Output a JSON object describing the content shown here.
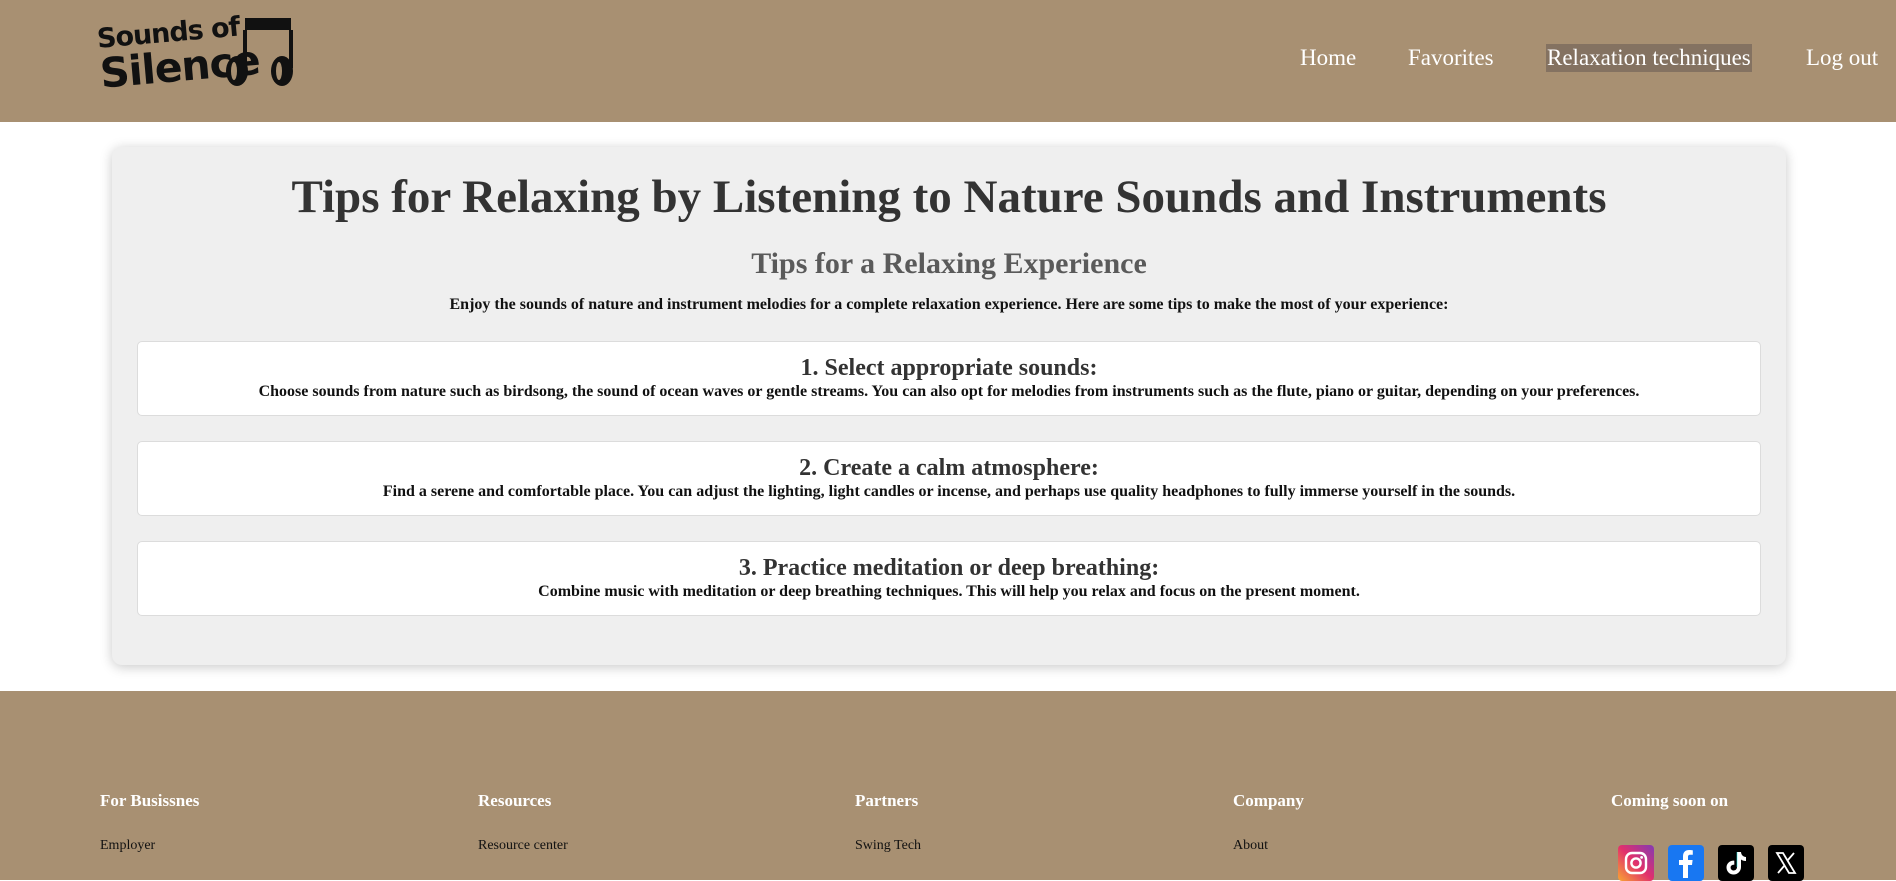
{
  "header": {
    "logo": {
      "line1": "Sounds of",
      "line2": "Silence",
      "icon": "headphones-icon"
    },
    "nav": [
      {
        "label": "Home"
      },
      {
        "label": "Favorites"
      },
      {
        "label": "Relaxation techniques",
        "active": true
      },
      {
        "label": "Log out"
      }
    ]
  },
  "main": {
    "title": "Tips for Relaxing by Listening to Nature Sounds and Instruments",
    "subtitle": "Tips for a Relaxing Experience",
    "intro": "Enjoy the sounds of nature and instrument melodies for a complete relaxation experience. Here are some tips to make the most of your experience:",
    "tips": [
      {
        "heading": "1. Select appropriate sounds:",
        "text": "Choose sounds from nature such as birdsong, the sound of ocean waves or gentle streams. You can also opt for melodies from instruments such as the flute, piano or guitar, depending on your preferences."
      },
      {
        "heading": "2. Create a calm atmosphere:",
        "text": "Find a serene and comfortable place. You can adjust the lighting, light candles or incense, and perhaps use quality headphones to fully immerse yourself in the sounds."
      },
      {
        "heading": "3. Practice meditation or deep breathing:",
        "text": "Combine music with meditation or deep breathing techniques. This will help you relax and focus on the present moment."
      }
    ]
  },
  "footer": {
    "columns": [
      {
        "heading": "For Busissnes",
        "link": "Employer"
      },
      {
        "heading": "Resources",
        "link": "Resource center"
      },
      {
        "heading": "Partners",
        "link": "Swing Tech"
      },
      {
        "heading": "Company",
        "link": "About"
      }
    ],
    "social_heading": "Coming soon on",
    "socials": [
      "instagram-icon",
      "facebook-icon",
      "tiktok-icon",
      "x-icon"
    ]
  },
  "colors": {
    "header_bg": "#a89072",
    "active_nav_bg": "#847261",
    "card_bg": "#efefef"
  }
}
